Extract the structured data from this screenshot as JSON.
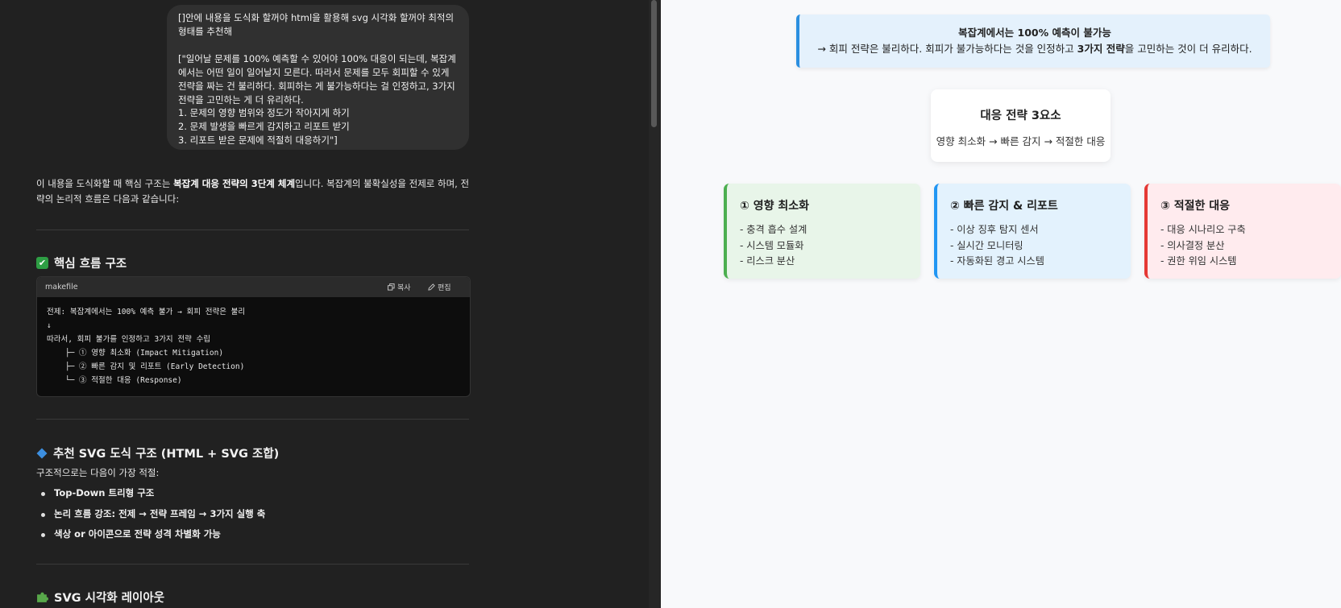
{
  "chat": {
    "user_message": {
      "line1": "[]안에 내용을 도식화 할꺼야 html을 활용해 svg 시각화 할꺼야 최적의 형태를 추천해",
      "line2": "[\"일어날 문제를 100% 예측할 수 있어야 100% 대응이 되는데, 복잡계에서는 어떤 일이 일어날지 모른다. 따라서 문제를 모두 회피할 수 있게 전략을 짜는 건 불리하다. 회피하는 게 불가능하다는 걸 인정하고, 3가지 전략을 고민하는 게 더 유리하다.",
      "line3": "1. 문제의 영향 범위와 정도가 작아지게 하기",
      "line4": "2. 문제 발생을 빠르게 감지하고 리포트 받기",
      "line5": "3. 리포트 받은 문제에 적절히 대응하기\"]"
    },
    "intro": {
      "pre": "이 내용을 도식화할 때 핵심 구조는 ",
      "bold": "복잡계 대응 전략의 3단계 체계",
      "post": "입니다. 복잡계의 불확실성을 전제로 하며, 전략의 논리적 흐름은 다음과 같습니다:"
    },
    "section1": {
      "icon": "✔",
      "title": "핵심 흐름 구조"
    },
    "code": {
      "lang": "makefile",
      "copy_label": "복사",
      "edit_label": "편집",
      "lines": [
        "전제: 복잡계에서는 100% 예측 불가 → 회피 전략은 불리",
        "↓",
        "따라서, 회피 불가를 인정하고 3가지 전략 수립",
        "    ├─ ① 영향 최소화 (Impact Mitigation)",
        "    ├─ ② 빠른 감지 및 리포트 (Early Detection)",
        "    └─ ③ 적절한 대응 (Response)"
      ]
    },
    "section2": {
      "title": "추천 SVG 도식 구조 (HTML + SVG 조합)"
    },
    "sub_text": "구조적으로는 다음이 가장 적절:",
    "bullets": [
      "Top-Down 트리형 구조",
      "논리 흐름 강조: 전제 → 전략 프레임 → 3가지 실행 축",
      "색상 or 아이콘으로 전략 성격 차별화 가능"
    ],
    "section3": {
      "title": "SVG 시각화 레이아웃"
    }
  },
  "preview": {
    "premise": {
      "title": "복잡계에서는 100% 예측이 불가능",
      "pre": "→ 회피 전략은 불리하다. 회피가 불가능하다는 것을 인정하고 ",
      "bold": "3가지 전략",
      "post": "을 고민하는 것이 더 유리하다."
    },
    "core": {
      "title": "대응 전략 3요소",
      "sub": "영향 최소화 → 빠른 감지 → 적절한 대응"
    },
    "cards": [
      {
        "title": "① 영향 최소화",
        "items": [
          "- 충격 흡수 설계",
          "- 시스템 모듈화",
          "- 리스크 분산"
        ]
      },
      {
        "title": "② 빠른 감지 & 리포트",
        "items": [
          "- 이상 징후 탐지 센서",
          "- 실시간 모니터링",
          "- 자동화된 경고 시스템"
        ]
      },
      {
        "title": "③ 적절한 대응",
        "items": [
          "- 대응 시나리오 구축",
          "- 의사결정 분산",
          "- 권한 위임 시스템"
        ]
      }
    ]
  },
  "colors": {
    "left_bg": "#212121",
    "right_bg": "#f8f9fb",
    "card1_bg": "#e8f5e9",
    "card1_border": "#4caf50",
    "card2_bg": "#e3f2fd",
    "card2_border": "#2196f3",
    "card3_bg": "#ffebee",
    "card3_border": "#e53935"
  }
}
